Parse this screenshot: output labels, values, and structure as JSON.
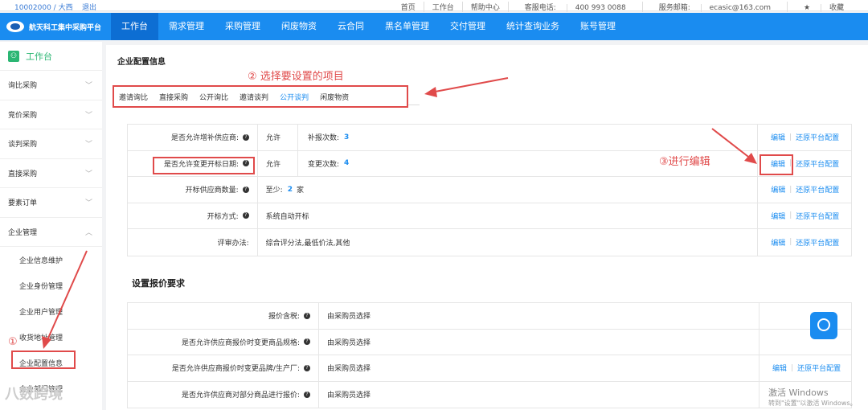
{
  "topbar": {
    "account": "10002000 / 大西",
    "logout": "退出",
    "links": [
      "首页",
      "工作台",
      "帮助中心"
    ],
    "phone_label": "客服电话:",
    "phone": "400 993 0088",
    "email_label": "服务邮箱:",
    "email": "ecasic@163.com",
    "favorite": "收藏"
  },
  "brand": "航天科工集中采购平台",
  "nav": [
    "工作台",
    "需求管理",
    "采购管理",
    "闲废物资",
    "云合同",
    "黑名单管理",
    "交付管理",
    "统计查询业务",
    "账号管理"
  ],
  "sidebar": {
    "header": "工作台",
    "items": [
      "询比采购",
      "竞价采购",
      "谈判采购",
      "直接采购",
      "要素订单",
      "企业管理"
    ],
    "subitems": [
      "企业信息维护",
      "企业身份管理",
      "企业用户管理",
      "收货地址管理",
      "企业配置信息",
      "企业部门管理"
    ]
  },
  "main": {
    "title": "企业配置信息",
    "tabs": [
      "邀请询比",
      "直接采购",
      "公开询比",
      "邀请谈判",
      "公开谈判",
      "闲废物资"
    ],
    "active_tab": "公开谈判",
    "rows": [
      {
        "label": "是否允许增补供应商:",
        "value": "允许",
        "extra_label": "补报次数:",
        "extra_num": "3"
      },
      {
        "label": "是否允许变更开标日期:",
        "value": "允许",
        "extra_label": "变更次数:",
        "extra_num": "4"
      },
      {
        "label": "开标供应商数量:",
        "value_prefix": "至少:",
        "value_num": "2",
        "value_suffix": "家"
      },
      {
        "label": "开标方式:",
        "value": "系统自动开标"
      },
      {
        "label": "评审办法:",
        "value": "综合评分法,最低价法,其他"
      }
    ],
    "edit": "编辑",
    "restore": "还原平台配置",
    "section": "设置报价要求",
    "rows2": [
      {
        "label": "报价含税:",
        "value": "由采购员选择"
      },
      {
        "label": "是否允许供应商报价时变更商品规格:",
        "value": "由采购员选择"
      },
      {
        "label": "是否允许供应商报价时变更品牌/生产厂:",
        "value": "由采购员选择"
      },
      {
        "label": "是否允许供应商对部分商品进行报价:",
        "value": "由采购员选择"
      }
    ]
  },
  "annotations": {
    "step1": "①",
    "step2": "② 选择要设置的项目",
    "step3": "③进行编辑"
  },
  "watermark": {
    "line1": "激活 Windows",
    "line2": "转到\"设置\"以激活 Windows。",
    "logo": "八数跨境"
  },
  "colors": {
    "primary": "#1a8cf0",
    "annotation": "#e04a4a",
    "sidebar_accent": "#2bb673"
  }
}
